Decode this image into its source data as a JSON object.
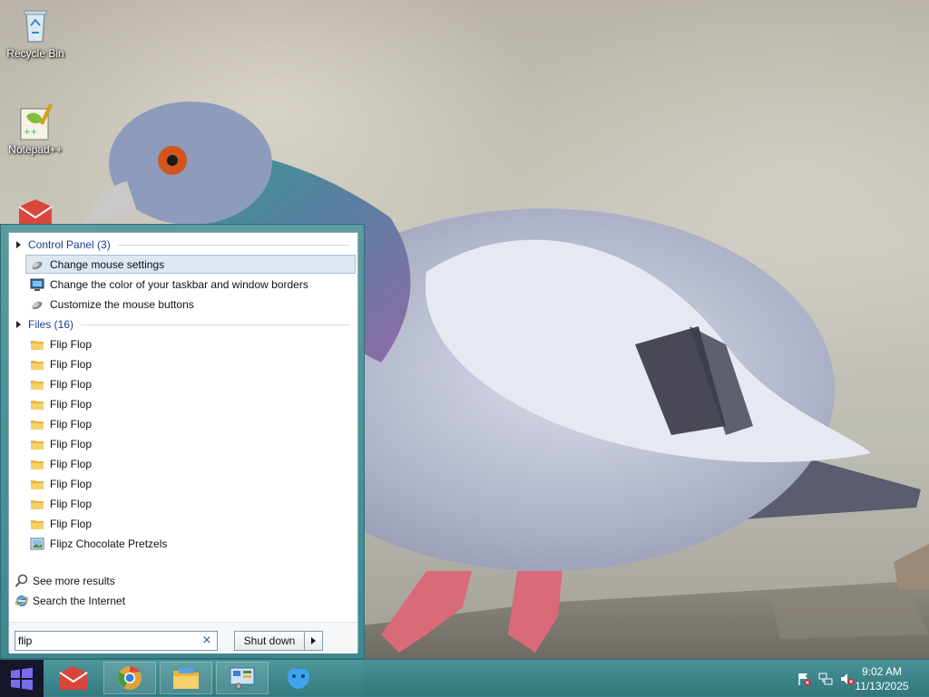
{
  "desktop": {
    "icons": [
      {
        "label": "Recycle Bin"
      },
      {
        "label": "Notepad++"
      }
    ]
  },
  "start_search": {
    "groups": [
      {
        "title": "Control Panel (3)",
        "items": [
          {
            "label": "Change mouse settings",
            "icon": "mouse-settings-icon",
            "selected": true
          },
          {
            "label": "Change the color of your taskbar and window borders",
            "icon": "personalization-icon"
          },
          {
            "label": "Customize the mouse buttons",
            "icon": "mouse-settings-icon"
          }
        ]
      },
      {
        "title": "Files (16)",
        "items": [
          {
            "label": "Flip Flop",
            "icon": "folder-icon"
          },
          {
            "label": "Flip Flop",
            "icon": "folder-icon"
          },
          {
            "label": "Flip Flop",
            "icon": "folder-icon"
          },
          {
            "label": "Flip Flop",
            "icon": "folder-icon"
          },
          {
            "label": "Flip Flop",
            "icon": "folder-icon"
          },
          {
            "label": "Flip Flop",
            "icon": "folder-icon"
          },
          {
            "label": "Flip Flop",
            "icon": "folder-icon"
          },
          {
            "label": "Flip Flop",
            "icon": "folder-icon"
          },
          {
            "label": "Flip Flop",
            "icon": "folder-icon"
          },
          {
            "label": "Flip Flop",
            "icon": "folder-icon"
          },
          {
            "label": "Flipz Chocolate Pretzels",
            "icon": "image-file-icon"
          }
        ]
      }
    ],
    "see_more": "See more results",
    "search_internet": "Search the Internet",
    "search_value": "flip",
    "clear_glyph": "×",
    "shutdown_label": "Shut down"
  },
  "taskbar": {
    "apps": [
      "parallels-app-icon",
      "chrome-app-icon",
      "file-explorer-app-icon",
      "control-panel-app-icon",
      "finder-app-icon"
    ],
    "clock_time": "9:02 AM",
    "clock_date": "11/13/2025"
  },
  "colors": {
    "accent": "#3f8890",
    "group_title": "#1b3f8c",
    "selection": "#dde7f2",
    "start_button": "#16162b"
  }
}
